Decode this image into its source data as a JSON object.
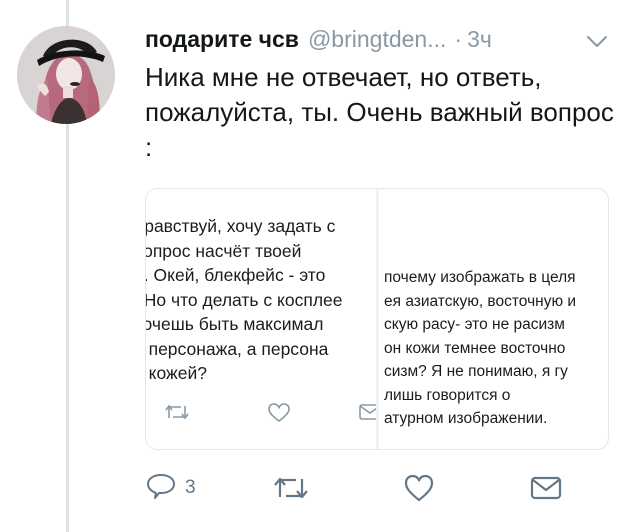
{
  "tweet": {
    "display_name": "подарите чсв",
    "handle": "@bringtden...",
    "separator": "·",
    "time": "3ч",
    "text": "Ника мне не отвечает, но ответь, пожалуйста, ты. Очень важный вопрос :"
  },
  "embedded_screenshot": {
    "left_text_lines": [
      "дравствуй, хочу задать с",
      " вопрос насчёт твоей",
      "и. Окей, блекфейс - это",
      ". Но что делать с косплее",
      " хочешь быть максимал",
      "а персонажа, а персона",
      "й кожей?"
    ],
    "right_text_lines": [
      "почему изображать в целя",
      "ея азиатскую, восточную и",
      "скую расу- это не расизм",
      "он кожи темнее восточно",
      "сизм? Я не понимаю, я гу",
      " лишь говорится о",
      "атурном изображении."
    ],
    "icons": [
      "retweet-icon",
      "heart-icon",
      "mail-icon"
    ]
  },
  "actions": {
    "reply_count": "3",
    "icons": [
      "reply-icon",
      "retweet-icon",
      "like-icon",
      "direct-message-icon"
    ]
  },
  "colors": {
    "text": "#14171a",
    "muted": "#8899a6",
    "icon": "#657786",
    "thread_line": "#dbe3e8",
    "border": "#e1e8ed"
  }
}
